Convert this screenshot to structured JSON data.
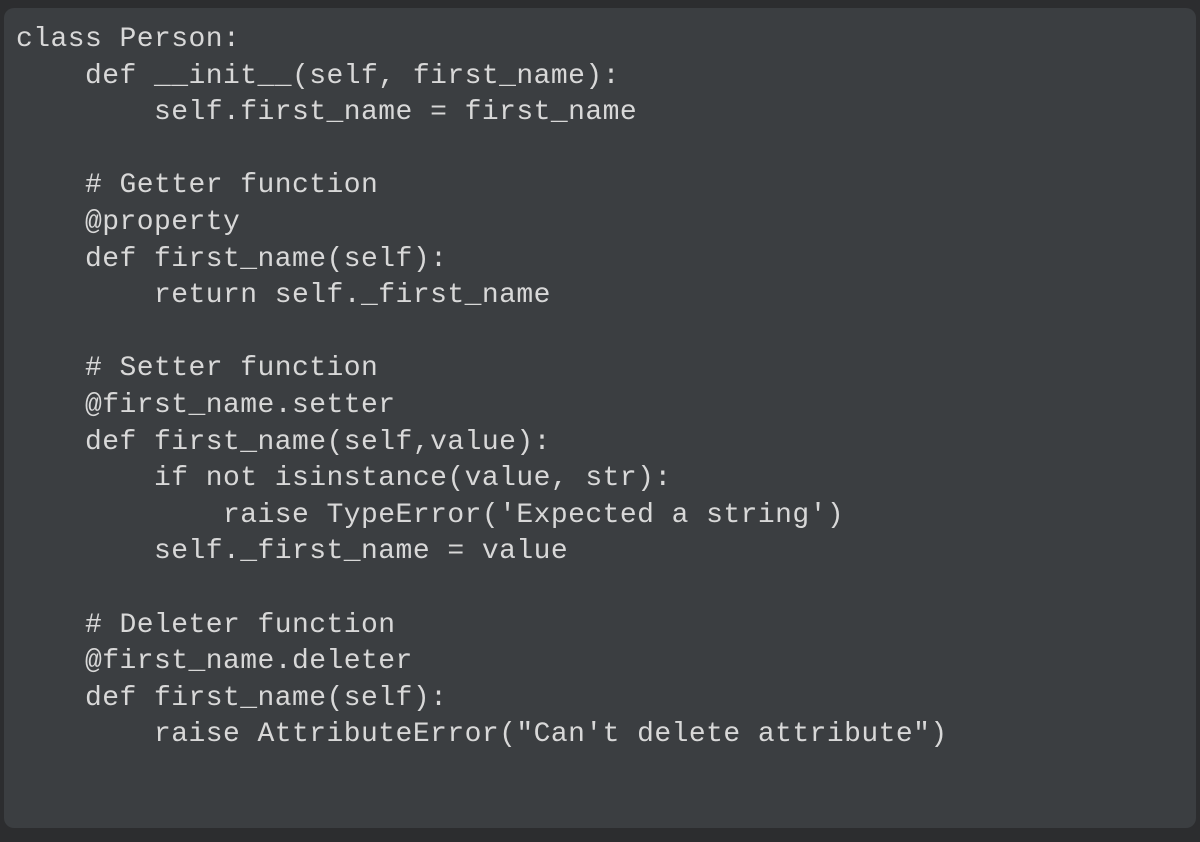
{
  "code": {
    "lines": [
      "class Person:",
      "    def __init__(self, first_name):",
      "        self.first_name = first_name",
      "",
      "    # Getter function",
      "    @property",
      "    def first_name(self):",
      "        return self._first_name",
      "",
      "    # Setter function",
      "    @first_name.setter",
      "    def first_name(self,value):",
      "        if not isinstance(value, str):",
      "            raise TypeError('Expected a string')",
      "        self._first_name = value",
      "",
      "    # Deleter function",
      "    @first_name.deleter",
      "    def first_name(self):",
      "        raise AttributeError(\"Can't delete attribute\")"
    ]
  },
  "colors": {
    "page_background": "#2c2d2f",
    "panel_background": "#3b3e41",
    "text": "#d8d8d8"
  }
}
